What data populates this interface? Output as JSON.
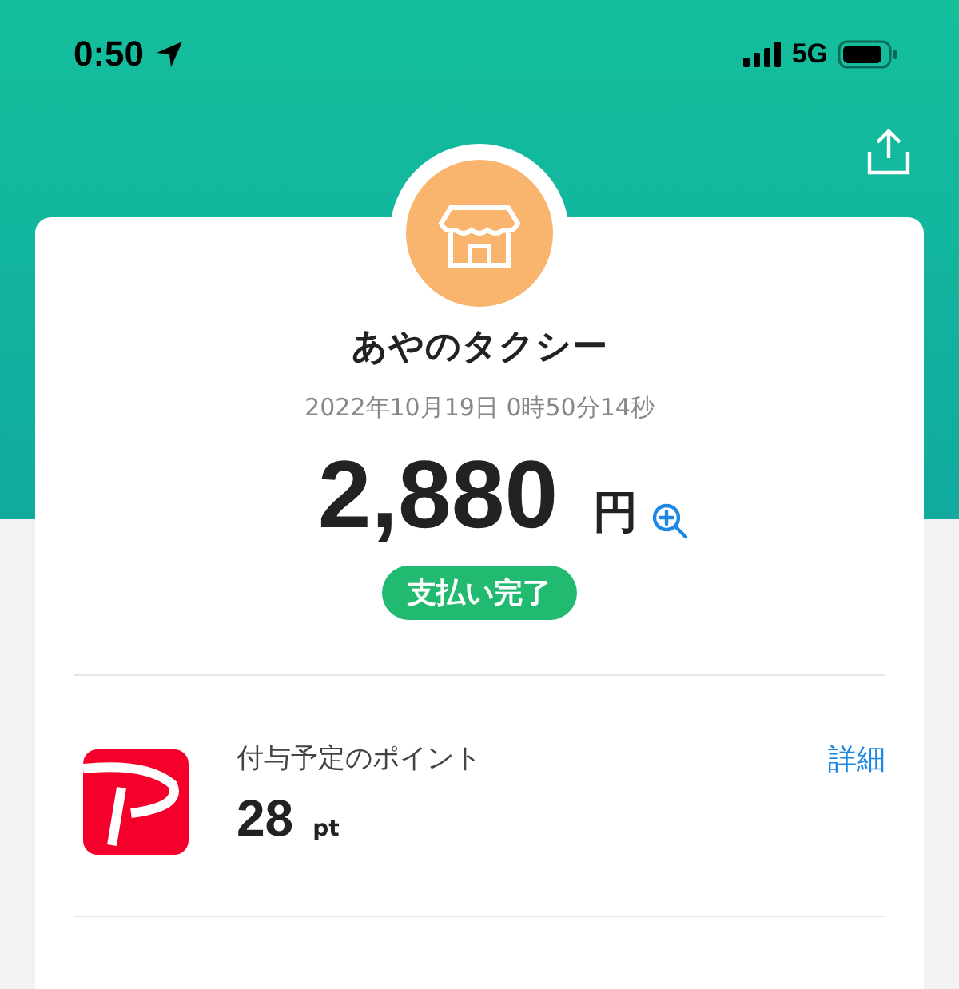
{
  "status_bar": {
    "time": "0:50",
    "network": "5G"
  },
  "receipt": {
    "shop_name": "あやのタクシー",
    "date": "2022年10月19日 0時50分14秒",
    "amount": "2,880",
    "currency": "円",
    "status": "支払い完了"
  },
  "points": {
    "label": "付与予定のポイント",
    "value": "28",
    "unit": "pt",
    "link": "詳細"
  }
}
